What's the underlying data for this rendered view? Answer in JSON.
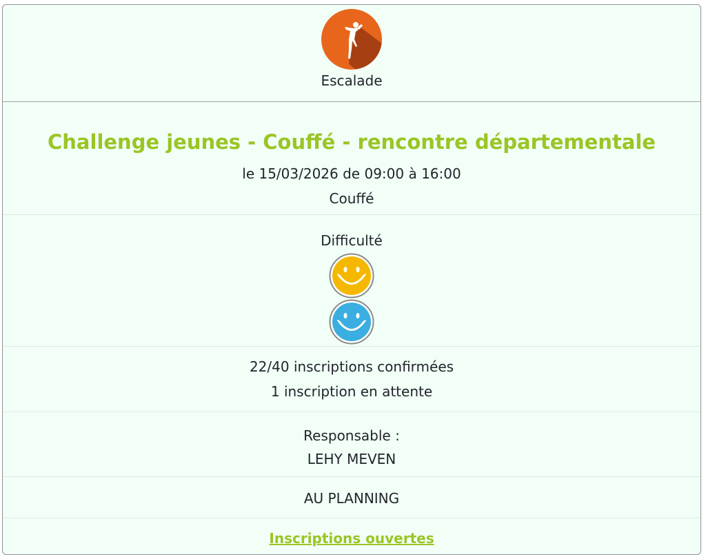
{
  "activity": {
    "name": "Escalade",
    "icon": "climber-icon",
    "icon_color": "#e8661c"
  },
  "event": {
    "title": "Challenge jeunes - Couffé - rencontre départementale",
    "title_color": "#9cc424",
    "date_line": "le 15/03/2026 de 09:00 à 16:00",
    "location": "Couffé"
  },
  "difficulty": {
    "label": "Difficulté",
    "levels": [
      {
        "icon": "smiley-yellow-icon",
        "color": "#f5b800"
      },
      {
        "icon": "smiley-blue-icon",
        "color": "#3aaee0"
      }
    ]
  },
  "registrations": {
    "confirmed": "22/40 inscriptions confirmées",
    "waiting": "1 inscription en attente"
  },
  "manager": {
    "label": "Responsable :",
    "name": "LEHY MEVEN"
  },
  "planning": {
    "status": "AU PLANNING"
  },
  "status_link": {
    "label": "Inscriptions ouvertes"
  }
}
